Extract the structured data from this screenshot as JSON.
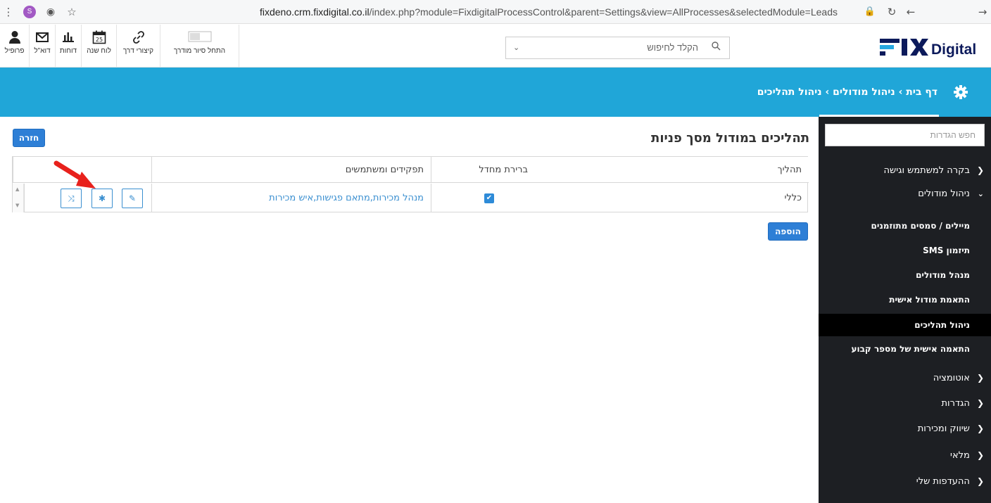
{
  "browser": {
    "url_host": "fixdeno.crm.fixdigital.co.il",
    "url_path": "/index.php?module=FixdigitalProcessControl&parent=Settings&view=AllProcesses&selectedModule=Leads",
    "profile_letter": "S"
  },
  "header": {
    "tools": [
      {
        "label": "פרופיל",
        "icon": "person-icon"
      },
      {
        "label": "דוא\"ל",
        "icon": "mail-icon"
      },
      {
        "label": "דוחות",
        "icon": "bar-chart-icon"
      },
      {
        "label": "לוח שנה",
        "icon": "calendar-icon",
        "day": "25"
      },
      {
        "label": "קיצורי דרך",
        "icon": "link-icon"
      },
      {
        "label": "התחל סיור מודרך",
        "icon": "toggle-icon"
      }
    ],
    "search_placeholder": "הקלד לחיפוש",
    "logo_text": "Digital",
    "logo_mark": "FIX"
  },
  "breadcrumb": {
    "home": "דף בית",
    "modules": "ניהול מודולים",
    "current": "ניהול תהליכים",
    "separator": "›"
  },
  "sidebar": {
    "search_placeholder": "חפש הגדרות",
    "sections_top": [
      {
        "label": "בקרה למשתמש וגישה",
        "expanded": false
      },
      {
        "label": "ניהול מודולים",
        "expanded": true
      }
    ],
    "sub_items": [
      {
        "label": "מיילים / סמסים מתוזמנים",
        "active": false
      },
      {
        "label": "תיזמון SMS",
        "active": false
      },
      {
        "label": "מנהל מודולים",
        "active": false
      },
      {
        "label": "התאמת מודול אישית",
        "active": false
      },
      {
        "label": "ניהול תהליכים",
        "active": true
      },
      {
        "label": "התאמה אישית של מספר קבוע",
        "active": false
      }
    ],
    "sections_bottom": [
      {
        "label": "אוטומציה"
      },
      {
        "label": "הגדרות"
      },
      {
        "label": "שיווק ומכירות"
      },
      {
        "label": "מלאי"
      },
      {
        "label": "ההעדפות שלי"
      }
    ]
  },
  "main": {
    "title": "תהליכים במודול מסך פניות",
    "back_label": "חזרה",
    "add_label": "הוספה",
    "table": {
      "headers": [
        "תהליך",
        "ברירת מחדל",
        "תפקידים ומשתמשים",
        ""
      ],
      "rows": [
        {
          "process": "כללי",
          "is_default": true,
          "roles": "מנהל מכירות,מתאם פגישות,איש מכירות"
        }
      ]
    }
  },
  "colors": {
    "band": "#20a6d8",
    "sidebar": "#1d1f23",
    "primary_button": "#2e7fd6",
    "link": "#3a8fd0",
    "arrow": "#e8211c"
  }
}
